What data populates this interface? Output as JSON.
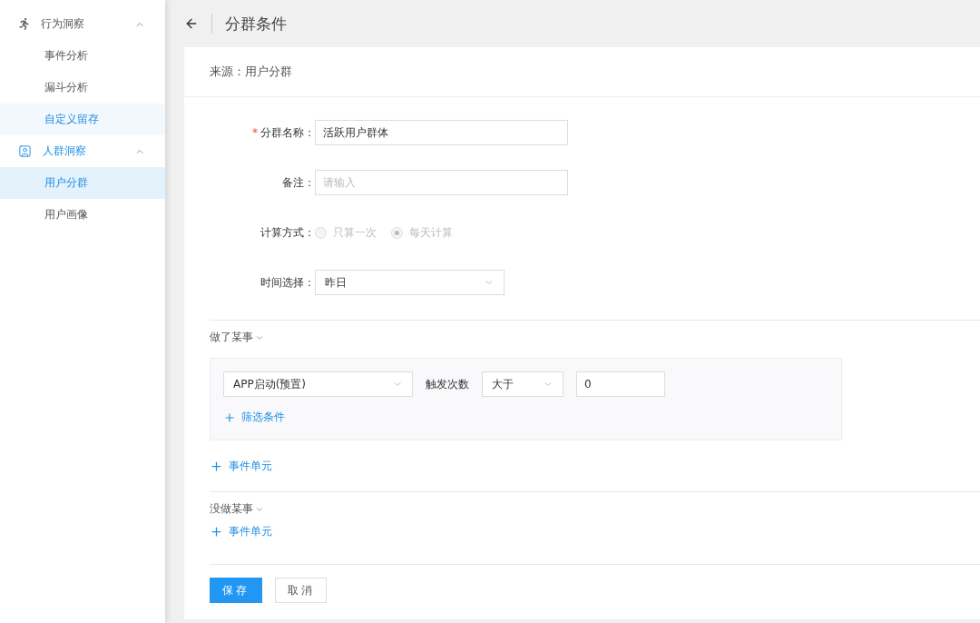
{
  "sidebar": {
    "groups": [
      {
        "label": "行为洞察",
        "expanded": true,
        "items": [
          {
            "label": "事件分析",
            "selected": false,
            "hovered": false
          },
          {
            "label": "漏斗分析",
            "selected": false,
            "hovered": false
          },
          {
            "label": "自定义留存",
            "selected": false,
            "hovered": true
          }
        ]
      },
      {
        "label": "人群洞察",
        "expanded": true,
        "items": [
          {
            "label": "用户分群",
            "selected": true,
            "hovered": false
          },
          {
            "label": "用户画像",
            "selected": false,
            "hovered": false
          }
        ]
      }
    ]
  },
  "header": {
    "title": "分群条件"
  },
  "source": "来源：用户分群",
  "form": {
    "name": {
      "label": "分群名称：",
      "required_mark": "*",
      "value": "活跃用户群体"
    },
    "note": {
      "label": "备注：",
      "placeholder": "请输入"
    },
    "calc": {
      "label": "计算方式：",
      "disabled": true,
      "options": [
        {
          "label": "只算一次",
          "selected": false
        },
        {
          "label": "每天计算",
          "selected": true
        }
      ]
    },
    "time": {
      "label": "时间选择：",
      "value": "昨日"
    }
  },
  "did": {
    "title": "做了某事",
    "units": [
      {
        "event": "APP启动(预置)",
        "metric": "触发次数",
        "operator": "大于",
        "value": "0",
        "filter_action": "筛选条件"
      }
    ],
    "add_unit": "事件单元"
  },
  "did_not": {
    "title": "没做某事",
    "add_unit": "事件单元"
  },
  "buttons": [
    {
      "label": "保存",
      "kind": "primary"
    },
    {
      "label": "取消",
      "kind": "default"
    }
  ]
}
